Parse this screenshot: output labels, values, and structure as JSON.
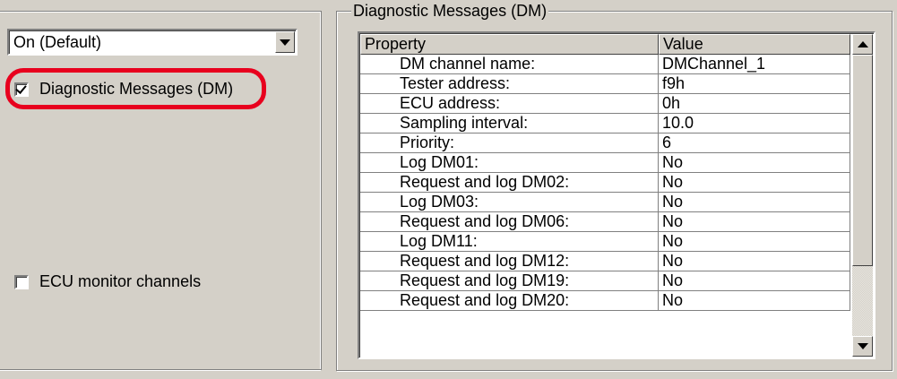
{
  "left": {
    "combo_value": "On (Default)",
    "dm_checkbox": {
      "label": "Diagnostic Messages (DM)",
      "checked": true
    },
    "ecu_checkbox": {
      "label": "ECU monitor channels",
      "checked": false
    },
    "highlight_color": "#e8001e"
  },
  "group": {
    "title": "Diagnostic Messages (DM)",
    "columns": [
      "Property",
      "Value"
    ],
    "rows": [
      [
        "DM channel name:",
        "DMChannel_1"
      ],
      [
        "Tester address:",
        "f9h"
      ],
      [
        "ECU address:",
        "0h"
      ],
      [
        "Sampling interval:",
        "10.0"
      ],
      [
        "Priority:",
        "6"
      ],
      [
        "Log DM01:",
        "No"
      ],
      [
        "Request and log DM02:",
        "No"
      ],
      [
        "Log DM03:",
        "No"
      ],
      [
        "Request and log DM06:",
        "No"
      ],
      [
        "Log DM11:",
        "No"
      ],
      [
        "Request and log DM12:",
        "No"
      ],
      [
        "Request and log DM19:",
        "No"
      ],
      [
        "Request and log DM20:",
        "No"
      ]
    ]
  },
  "icons": {
    "combo_dropdown": "chevron-down-icon",
    "scroll_up": "scroll-up-arrow-icon",
    "scroll_down": "scroll-down-arrow-icon",
    "checkmark": "checkmark-icon"
  }
}
